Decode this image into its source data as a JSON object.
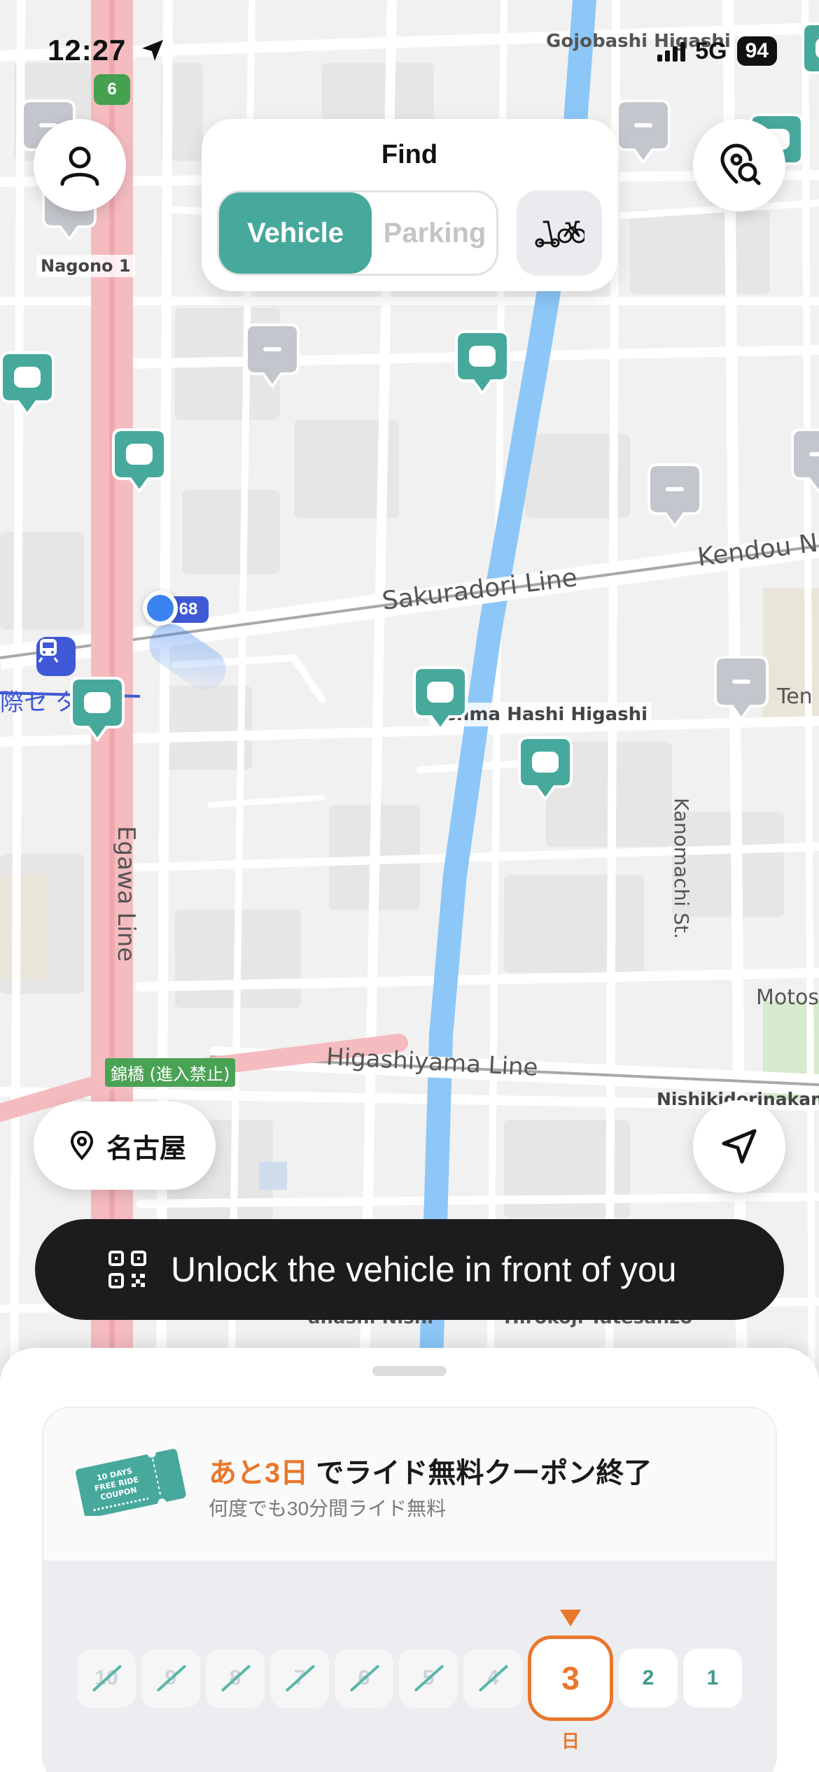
{
  "status_bar": {
    "time": "12:27",
    "network": "5G",
    "battery": "94"
  },
  "map": {
    "labels": {
      "gojobashi_higashi": "Gojobashi Higashi",
      "nagono_1": "Nagono 1",
      "sakuradori_line": "Sakuradori Line",
      "kendou": "Kendou N",
      "tenma_hashi": "Tenma Hashi Higashi",
      "kanomachi": "Kanomachi St.",
      "ten": "Ten",
      "egawa_line": "Egawa Line",
      "motos": "Motos",
      "higashiyama_line": "Higashiyama Line",
      "nishikidori": "Nishikidorinakanoc",
      "nishiki_bridge": "錦橋 (進入禁止)",
      "station_jp": "際セ  タ－",
      "route_6": "6",
      "route_68": "68",
      "hidden_1": "anashi Nishi",
      "hidden_2": "Hirokoji Tatesanzo"
    }
  },
  "find_panel": {
    "title": "Find",
    "tabs": {
      "vehicle": "Vehicle",
      "parking": "Parking"
    }
  },
  "location_pill": {
    "label": "名古屋"
  },
  "unlock_bar": {
    "label": "Unlock the vehicle in front of you"
  },
  "promo": {
    "highlight": "あと3日",
    "title_rest": " でライド無料クーポン終了",
    "subtitle": "何度でも30分間ライド無料",
    "coupon_text": "10 DAYS FREE RIDE COUPON",
    "days": [
      "10",
      "9",
      "8",
      "7",
      "6",
      "5",
      "4",
      "3",
      "2",
      "1"
    ],
    "current_day": "3",
    "current_day_label": "日"
  },
  "colors": {
    "brand_teal": "#46a99c",
    "accent_orange": "#e9772c",
    "unlock_bg": "#1c1c1e"
  }
}
